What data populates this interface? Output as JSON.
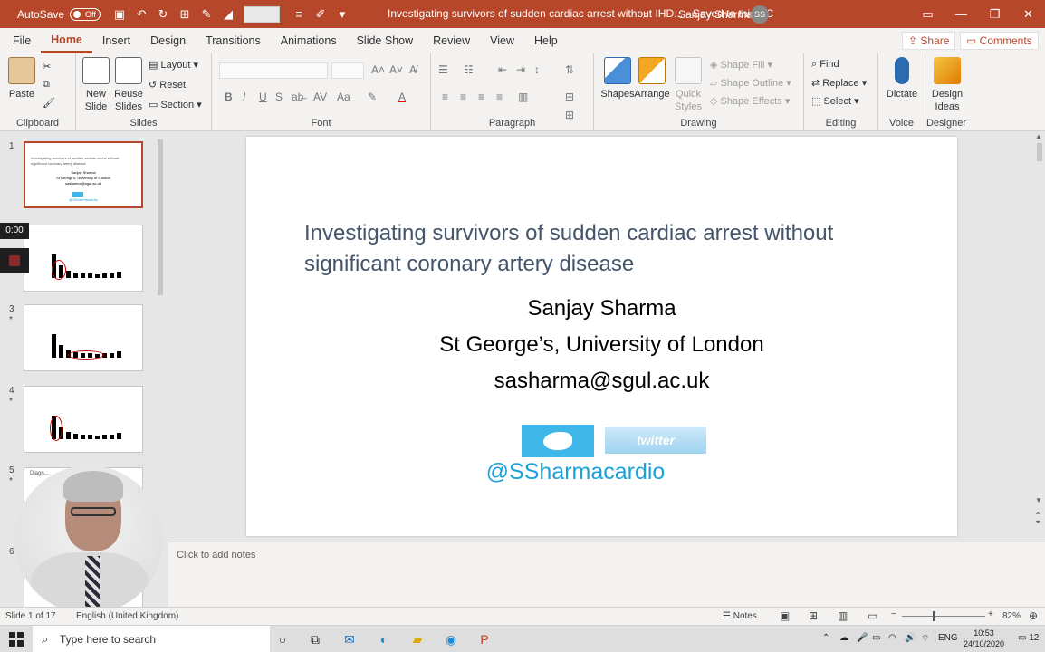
{
  "titlebar": {
    "autosave_label": "AutoSave",
    "autosave_state": "Off",
    "doc_title": "Investigating survivors of sudden cardiac arrest without IHD...  -  Saved to this PC",
    "user_name": "Sanjay Sharma",
    "user_initials": "SS"
  },
  "tabs": [
    "File",
    "Home",
    "Insert",
    "Design",
    "Transitions",
    "Animations",
    "Slide Show",
    "Review",
    "View",
    "Help"
  ],
  "share_label": "Share",
  "comments_label": "Comments",
  "ribbon": {
    "clipboard": {
      "paste": "Paste",
      "label": "Clipboard"
    },
    "slides": {
      "new_slide": "New Slide",
      "reuse_slides": "Reuse Slides",
      "layout": "Layout",
      "reset": "Reset",
      "section": "Section",
      "label": "Slides"
    },
    "font": {
      "label": "Font"
    },
    "paragraph": {
      "label": "Paragraph"
    },
    "drawing": {
      "shapes": "Shapes",
      "arrange": "Arrange",
      "quick_styles": "Quick Styles",
      "shape_fill": "Shape Fill",
      "shape_outline": "Shape Outline",
      "shape_effects": "Shape Effects",
      "label": "Drawing"
    },
    "editing": {
      "find": "Find",
      "replace": "Replace",
      "select": "Select",
      "label": "Editing"
    },
    "voice": {
      "dictate": "Dictate",
      "label": "Voice"
    },
    "designer": {
      "design_ideas": "Design Ideas",
      "label": "Designer"
    }
  },
  "thumbnails": {
    "numbers": [
      "1",
      "2",
      "3",
      "4",
      "5",
      "6"
    ],
    "stars": [
      "*",
      "*",
      "*"
    ],
    "slide1_lines": [
      "Investigating survivors of sudden cardiac arrest without",
      "significant coronary artery disease",
      "Sanjay Sharma",
      "St George's, University of London",
      "sasharma@sgul.ac.uk",
      "@SSharmacardio"
    ],
    "slide5_title": "Diagn..."
  },
  "recording": {
    "timer": "0:00"
  },
  "slide": {
    "title_line1": "Investigating survivors of sudden cardiac arrest without",
    "title_line2": "significant coronary artery disease",
    "name": "Sanjay Sharma",
    "affiliation": "St George’s, University of London",
    "email": "sasharma@sgul.ac.uk",
    "twitter_word": "twitter",
    "handle": "@SSharmacardio"
  },
  "notes_placeholder": "Click to add notes",
  "status": {
    "slide_count": "Slide 1 of 17",
    "language": "English (United Kingdom)",
    "notes_label": "Notes",
    "zoom": "82%"
  },
  "taskbar": {
    "search_placeholder": "Type here to search",
    "lang": "ENG",
    "time": "10:53",
    "date": "24/10/2020",
    "notif_count": "12"
  },
  "colors": {
    "accent": "#b7472a",
    "title_text": "#44546a",
    "handle": "#1ca1d9"
  }
}
